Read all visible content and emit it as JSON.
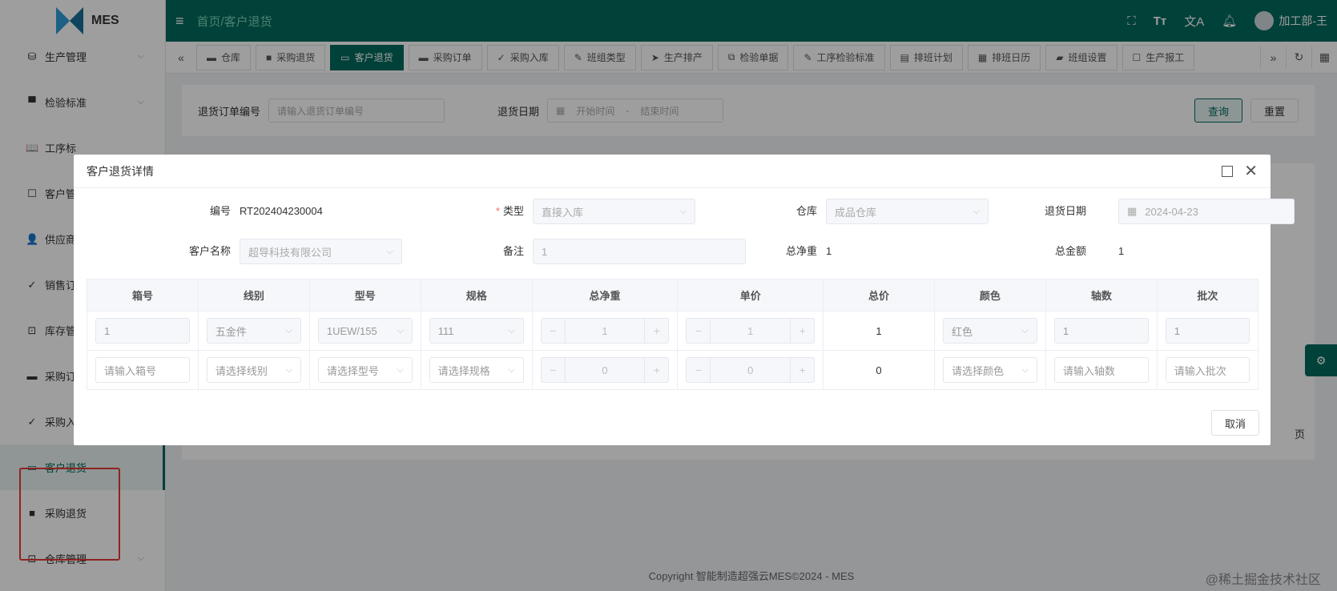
{
  "app": {
    "logo_text": "MES",
    "header_title": "首页/客户退货",
    "user_name": "加工部-王"
  },
  "sidebar": {
    "items": [
      {
        "label": "生产管理",
        "icon": "⛁",
        "has_chevron": true
      },
      {
        "label": "检验标准",
        "icon": "▀",
        "has_chevron": true
      },
      {
        "label": "工序标",
        "icon": "📖",
        "has_chevron": false
      },
      {
        "label": "客户管",
        "icon": "☐",
        "has_chevron": false
      },
      {
        "label": "供应商",
        "icon": "👤",
        "has_chevron": false
      },
      {
        "label": "销售订",
        "icon": "✓",
        "has_chevron": false
      },
      {
        "label": "库存管",
        "icon": "⊡",
        "has_chevron": false
      },
      {
        "label": "采购订",
        "icon": "▬",
        "has_chevron": false
      },
      {
        "label": "采购入",
        "icon": "✓",
        "has_chevron": false
      },
      {
        "label": "客户退货",
        "icon": "▭",
        "has_chevron": false,
        "active": true
      },
      {
        "label": "采购退货",
        "icon": "■",
        "has_chevron": false
      },
      {
        "label": "仓库管理",
        "icon": "⊡",
        "has_chevron": true
      }
    ]
  },
  "tabs": [
    {
      "label": "仓库",
      "icon": "▬"
    },
    {
      "label": "采购退货",
      "icon": "■"
    },
    {
      "label": "客户退货",
      "icon": "▭",
      "active": true
    },
    {
      "label": "采购订单",
      "icon": "▬"
    },
    {
      "label": "采购入库",
      "icon": "✓"
    },
    {
      "label": "班组类型",
      "icon": "✎"
    },
    {
      "label": "生产排产",
      "icon": "➤"
    },
    {
      "label": "检验单据",
      "icon": "⧉"
    },
    {
      "label": "工序检验标准",
      "icon": "✎"
    },
    {
      "label": "排班计划",
      "icon": "▤"
    },
    {
      "label": "排班日历",
      "icon": "▦"
    },
    {
      "label": "班组设置",
      "icon": "▰"
    },
    {
      "label": "生产报工",
      "icon": "☐"
    }
  ],
  "search": {
    "order_label": "退货订单编号",
    "order_placeholder": "请输入退货订单编号",
    "date_label": "退货日期",
    "date_start": "开始时间",
    "date_sep": "-",
    "date_end": "结束时间",
    "query_btn": "查询",
    "reset_btn": "重置"
  },
  "page_suffix": "页",
  "footer": "Copyright 智能制造超强云MES©2024 - MES",
  "watermark": "@稀土掘金技术社区",
  "modal": {
    "title": "客户退货详情",
    "fields": {
      "code_label": "编号",
      "code_value": "RT202404230004",
      "type_label": "类型",
      "type_value": "直接入库",
      "warehouse_label": "仓库",
      "warehouse_value": "成品仓库",
      "date_label": "退货日期",
      "date_value": "2024-04-23",
      "customer_label": "客户名称",
      "customer_value": "超导科技有限公司",
      "remark_label": "备注",
      "remark_value": "1",
      "net_weight_label": "总净重",
      "net_weight_value": "1",
      "amount_label": "总金额",
      "amount_value": "1"
    },
    "table": {
      "headers": [
        "箱号",
        "线别",
        "型号",
        "规格",
        "总净重",
        "单价",
        "总价",
        "颜色",
        "轴数",
        "批次"
      ],
      "rows": [
        {
          "box": "1",
          "line": "五金件",
          "model": "1UEW/155",
          "spec": "111",
          "weight": "1",
          "price": "1",
          "total": "1",
          "color": "红色",
          "axes": "1",
          "batch": "1"
        },
        {
          "box": "请输入箱号",
          "line": "请选择线别",
          "model": "请选择型号",
          "spec": "请选择规格",
          "weight": "0",
          "price": "0",
          "total": "0",
          "color": "请选择颜色",
          "axes": "请输入轴数",
          "batch": "请输入批次"
        }
      ]
    },
    "cancel_btn": "取消"
  }
}
